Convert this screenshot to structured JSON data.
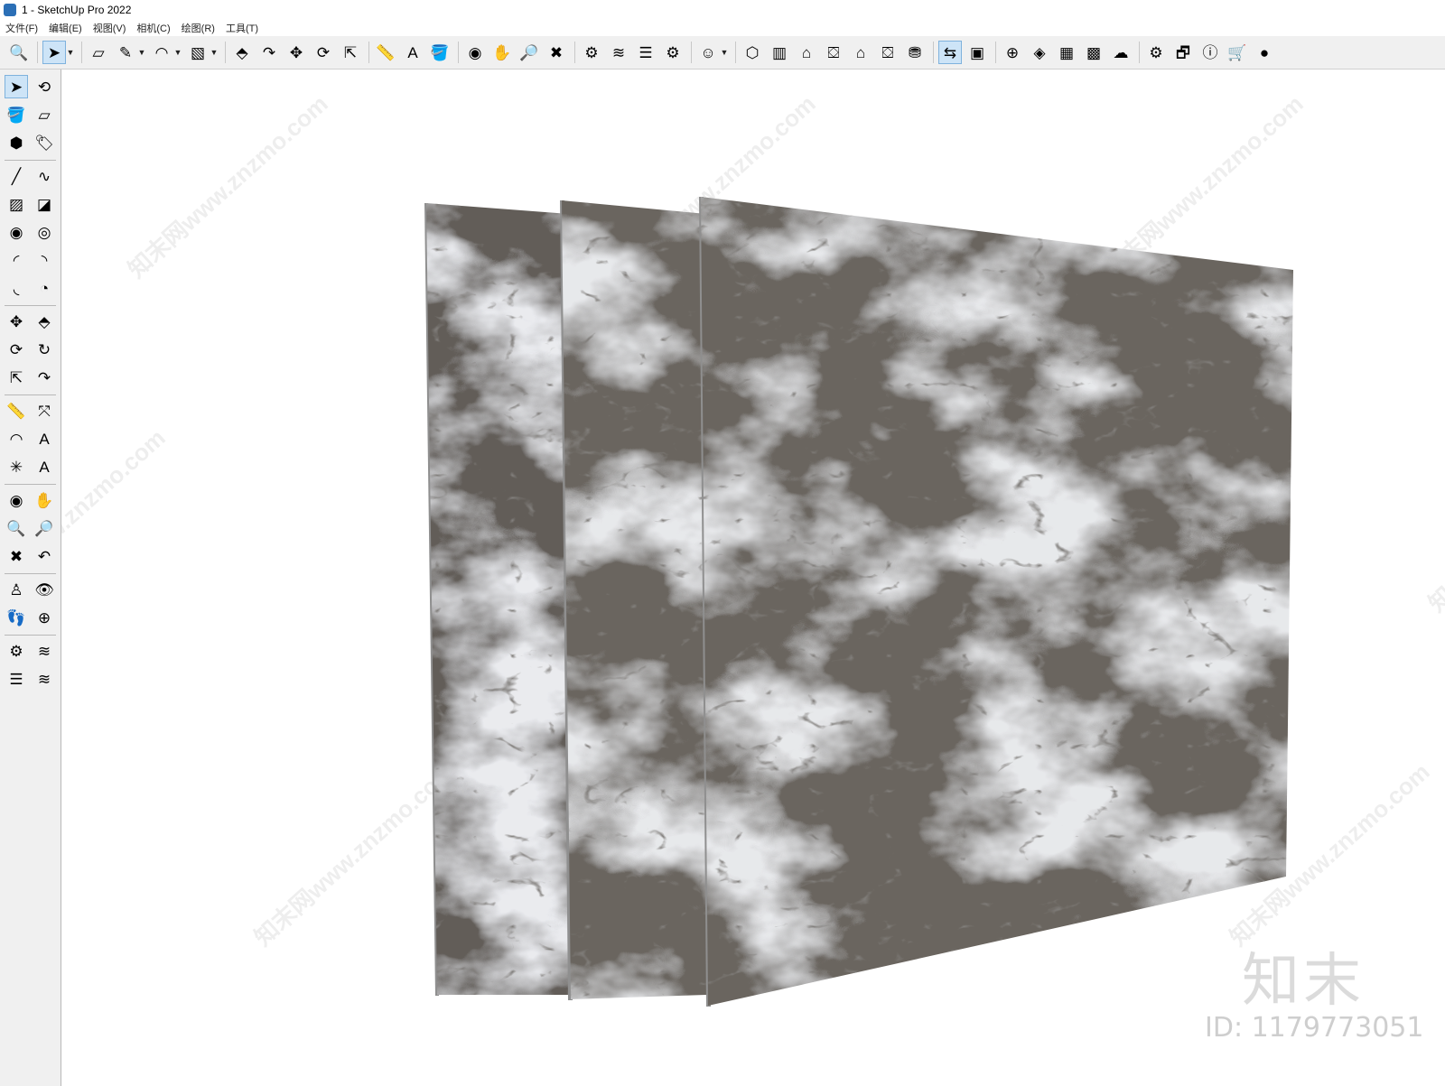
{
  "window": {
    "title": "1 - SketchUp Pro 2022"
  },
  "menu": {
    "items": [
      "文件(F)",
      "编辑(E)",
      "视图(V)",
      "相机(C)",
      "绘图(R)",
      "工具(T)"
    ]
  },
  "toolbar": {
    "buttons": [
      {
        "name": "zoom-icon",
        "glyph": "🔍"
      },
      {
        "name": "select-icon",
        "glyph": "➤",
        "active": true
      },
      {
        "name": "eraser-icon",
        "glyph": "▱"
      },
      {
        "name": "pencil-icon",
        "glyph": "✎"
      },
      {
        "name": "arc-icon",
        "glyph": "◠"
      },
      {
        "name": "rectangle-icon",
        "glyph": "▧"
      },
      {
        "name": "push-pull-icon",
        "glyph": "⬘"
      },
      {
        "name": "follow-me-icon",
        "glyph": "↷"
      },
      {
        "name": "move-icon",
        "glyph": "✥"
      },
      {
        "name": "rotate-icon",
        "glyph": "⟳"
      },
      {
        "name": "scale-icon",
        "glyph": "⇱"
      },
      {
        "name": "tape-measure-icon",
        "glyph": "📏"
      },
      {
        "name": "text-icon",
        "glyph": "A"
      },
      {
        "name": "paint-bucket-icon",
        "glyph": "🪣"
      },
      {
        "name": "orbit-icon",
        "glyph": "◉"
      },
      {
        "name": "pan-icon",
        "glyph": "✋"
      },
      {
        "name": "zoom-window-icon",
        "glyph": "🔎"
      },
      {
        "name": "zoom-extents-icon",
        "glyph": "✖"
      },
      {
        "name": "components-icon",
        "glyph": "⚙"
      },
      {
        "name": "styles-icon",
        "glyph": "≋"
      },
      {
        "name": "layers-icon",
        "glyph": "☰"
      },
      {
        "name": "tags-icon",
        "glyph": "⚙"
      },
      {
        "name": "account-icon",
        "glyph": "☺"
      },
      {
        "name": "iso-view-icon",
        "glyph": "⬡"
      },
      {
        "name": "top-view-icon",
        "glyph": "▥"
      },
      {
        "name": "front-view-icon",
        "glyph": "⌂"
      },
      {
        "name": "right-view-icon",
        "glyph": "⛋"
      },
      {
        "name": "back-view-icon",
        "glyph": "⌂"
      },
      {
        "name": "left-view-icon",
        "glyph": "⛋"
      },
      {
        "name": "warehouse-icon",
        "glyph": "⛃"
      },
      {
        "name": "share-model-icon",
        "glyph": "⇆",
        "active": true
      },
      {
        "name": "extension-icon",
        "glyph": "▣"
      },
      {
        "name": "add-location-icon",
        "glyph": "⊕"
      },
      {
        "name": "geo-location-icon",
        "glyph": "◈"
      },
      {
        "name": "sandbox-icon",
        "glyph": "▦"
      },
      {
        "name": "texture-icon",
        "glyph": "▩"
      },
      {
        "name": "cloud-upload-icon",
        "glyph": "☁"
      },
      {
        "name": "settings-icon",
        "glyph": "⚙"
      },
      {
        "name": "dialog-icon",
        "glyph": "🗗"
      },
      {
        "name": "info-icon",
        "glyph": "ⓘ"
      },
      {
        "name": "cart-icon",
        "glyph": "🛒"
      },
      {
        "name": "user-icon",
        "glyph": "●"
      }
    ]
  },
  "left_toolbar": {
    "buttons": [
      {
        "name": "select-icon",
        "glyph": "➤",
        "active": true
      },
      {
        "name": "lasso-icon",
        "glyph": "⟲"
      },
      {
        "name": "paint-bucket-icon",
        "glyph": "🪣"
      },
      {
        "name": "eraser-icon",
        "glyph": "▱"
      },
      {
        "name": "make-component-icon",
        "glyph": "⬢"
      },
      {
        "name": "tag-icon",
        "glyph": "🏷"
      },
      {
        "name": "line-icon",
        "glyph": "╱"
      },
      {
        "name": "freehand-icon",
        "glyph": "∿"
      },
      {
        "name": "rectangle-icon",
        "glyph": "▨"
      },
      {
        "name": "rotated-rect-icon",
        "glyph": "◪"
      },
      {
        "name": "circle-icon",
        "glyph": "◉"
      },
      {
        "name": "polygon-icon",
        "glyph": "◎"
      },
      {
        "name": "arc-icon",
        "glyph": "◜"
      },
      {
        "name": "two-point-arc-icon",
        "glyph": "◝"
      },
      {
        "name": "three-point-arc-icon",
        "glyph": "◟"
      },
      {
        "name": "pie-icon",
        "glyph": "◔"
      },
      {
        "name": "move-icon",
        "glyph": "✥"
      },
      {
        "name": "push-pull-icon",
        "glyph": "⬘"
      },
      {
        "name": "rotate-icon",
        "glyph": "⟳"
      },
      {
        "name": "follow-me-icon",
        "glyph": "↻"
      },
      {
        "name": "scale-icon",
        "glyph": "⇱"
      },
      {
        "name": "offset-icon",
        "glyph": "↷"
      },
      {
        "name": "tape-measure-icon",
        "glyph": "📏"
      },
      {
        "name": "dimension-icon",
        "glyph": "⤧"
      },
      {
        "name": "protractor-icon",
        "glyph": "◠"
      },
      {
        "name": "text-icon",
        "glyph": "A"
      },
      {
        "name": "axes-icon",
        "glyph": "✳"
      },
      {
        "name": "3d-text-icon",
        "glyph": "A"
      },
      {
        "name": "orbit-icon",
        "glyph": "◉"
      },
      {
        "name": "pan-icon",
        "glyph": "✋"
      },
      {
        "name": "zoom-icon",
        "glyph": "🔍"
      },
      {
        "name": "zoom-window-icon",
        "glyph": "🔎"
      },
      {
        "name": "zoom-extents-icon",
        "glyph": "✖"
      },
      {
        "name": "previous-view-icon",
        "glyph": "↶"
      },
      {
        "name": "position-camera-icon",
        "glyph": "♙"
      },
      {
        "name": "look-around-icon",
        "glyph": "👁"
      },
      {
        "name": "walk-icon",
        "glyph": "👣"
      },
      {
        "name": "section-plane-icon",
        "glyph": "⊕"
      },
      {
        "name": "components-icon",
        "glyph": "⚙"
      },
      {
        "name": "styles-icon",
        "glyph": "≋"
      },
      {
        "name": "layers-icon",
        "glyph": "☰"
      },
      {
        "name": "tags-icon",
        "glyph": "≋"
      }
    ]
  },
  "viewport": {
    "watermark_text": "知末网www.znzmo.com",
    "brand_logo": "知末",
    "id_label": "ID: 1179773051"
  },
  "colors": {
    "marble_light": "#d2d5d8",
    "marble_dark": "#6b6661",
    "vein": "#3f3c3a",
    "edge": "#8f8f8f"
  }
}
